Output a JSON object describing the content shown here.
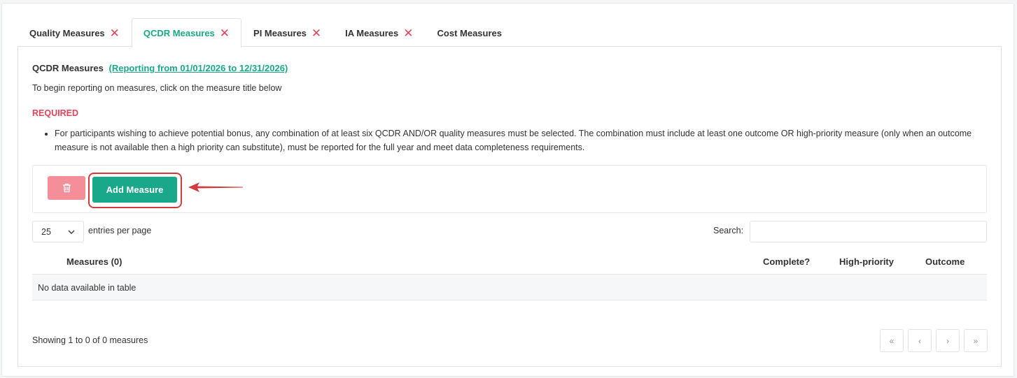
{
  "tabs": [
    {
      "label": "Quality Measures",
      "closable": true,
      "active": false
    },
    {
      "label": "QCDR Measures",
      "closable": true,
      "active": true
    },
    {
      "label": "PI Measures",
      "closable": true,
      "active": false
    },
    {
      "label": "IA Measures",
      "closable": true,
      "active": false
    },
    {
      "label": "Cost Measures",
      "closable": false,
      "active": false
    }
  ],
  "close_glyph": "✕",
  "panel": {
    "title": "QCDR Measures",
    "reporting_link": "(Reporting from 01/01/2026 to 12/31/2026)",
    "subtitle": "To begin reporting on measures, click on the measure title below",
    "required_label": "REQUIRED",
    "requirements": [
      "For participants wishing to achieve potential bonus, any combination of at least six QCDR AND/OR quality measures must be selected. The combination must include at least one outcome OR high-priority measure (only when an outcome measure is not available then a high priority can substitute), must be reported for the full year and meet data completeness requirements."
    ]
  },
  "toolbar": {
    "delete_icon": "trash-icon",
    "add_label": "Add Measure"
  },
  "table_controls": {
    "page_length": "25",
    "length_label": "entries per page",
    "search_label": "Search:",
    "search_value": ""
  },
  "table": {
    "columns": [
      "Measures (0)",
      "Complete?",
      "High-priority",
      "Outcome"
    ],
    "empty_text": "No data available in table",
    "info": "Showing 1 to 0 of 0 measures"
  },
  "pagination": [
    "«",
    "‹",
    "›",
    "»"
  ],
  "colors": {
    "accent": "#1aa88a",
    "danger": "#e0445a",
    "delete_button": "#f48f9a",
    "highlight_box": "#d23c3c"
  }
}
